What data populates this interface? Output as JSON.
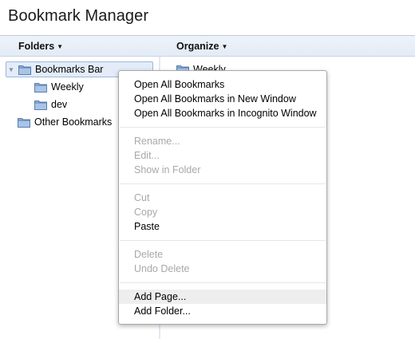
{
  "app": {
    "title": "Bookmark Manager"
  },
  "toolbar": {
    "folders_label": "Folders",
    "organize_label": "Organize"
  },
  "sidebar": {
    "items": [
      {
        "label": "Bookmarks Bar",
        "icon": "folder-icon",
        "expanded": true,
        "selected": true
      },
      {
        "label": "Weekly",
        "icon": "folder-icon"
      },
      {
        "label": "dev",
        "icon": "folder-icon"
      },
      {
        "label": "Other Bookmarks",
        "icon": "folder-icon"
      }
    ]
  },
  "main": {
    "items": [
      {
        "label": "Weekly",
        "icon": "folder-icon"
      }
    ]
  },
  "context_menu": {
    "groups": [
      [
        {
          "label": "Open All Bookmarks",
          "enabled": true
        },
        {
          "label": "Open All Bookmarks in New Window",
          "enabled": true
        },
        {
          "label": "Open All Bookmarks in Incognito Window",
          "enabled": true
        }
      ],
      [
        {
          "label": "Rename...",
          "enabled": false
        },
        {
          "label": "Edit...",
          "enabled": false
        },
        {
          "label": "Show in Folder",
          "enabled": false
        }
      ],
      [
        {
          "label": "Cut",
          "enabled": false
        },
        {
          "label": "Copy",
          "enabled": false
        },
        {
          "label": "Paste",
          "enabled": true
        }
      ],
      [
        {
          "label": "Delete",
          "enabled": false
        },
        {
          "label": "Undo Delete",
          "enabled": false
        }
      ],
      [
        {
          "label": "Add Page...",
          "enabled": true,
          "highlighted": true
        },
        {
          "label": "Add Folder...",
          "enabled": true
        }
      ]
    ]
  },
  "colors": {
    "toolbar_bg": "#e3ebf6",
    "selection_bg": "#e3ecf8",
    "selection_border": "#9db7dd",
    "folder_fill": "#8fb0d8",
    "disabled_text": "#a8a8a8"
  }
}
